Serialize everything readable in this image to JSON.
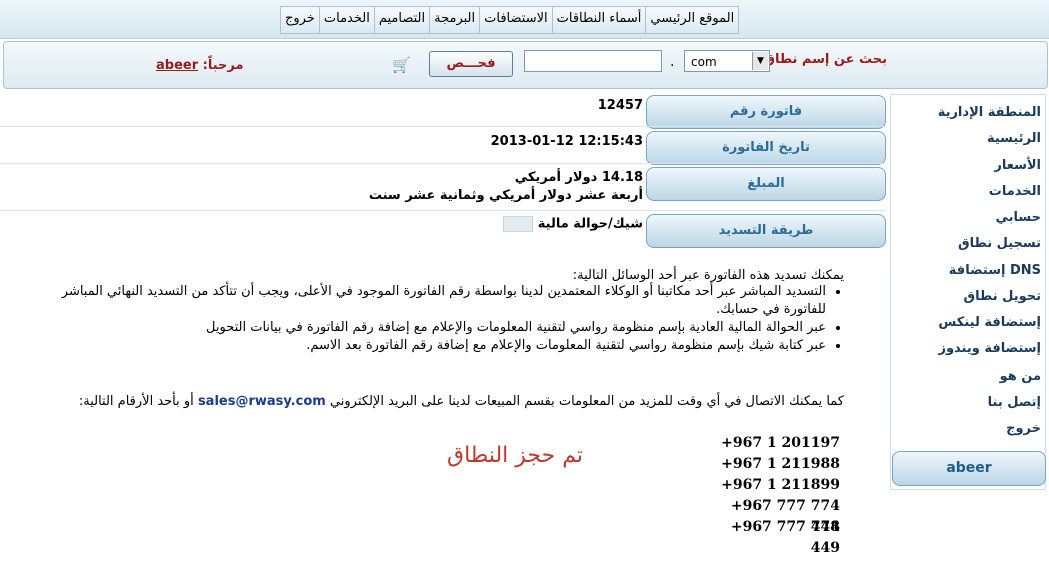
{
  "nav": {
    "items": [
      "الموقع الرئيسي",
      "أسماء النطاقات",
      "الاستضافات",
      "البرمجة",
      "التصاميم",
      "الخدمات",
      "خروج"
    ]
  },
  "search": {
    "label": "بحث عن إسم نطاق",
    "tld_selected": "com",
    "dot": ".",
    "name_value": "",
    "check_button": "فحـــص",
    "welcome_prefix": "مرحباً:",
    "username": "abeer"
  },
  "sidebar": {
    "items": [
      "المنطقة الإدارية",
      "الرئيسية",
      "الأسعار",
      "الخدمات",
      "حسابي",
      "تسجيل نطاق",
      "إستضافة DNS",
      "تحويل نطاق",
      "إستضافة لينكس",
      "إستضافة ويندوز",
      "من هو",
      "إتصل بنا",
      "خروج"
    ],
    "user_button": "abeer"
  },
  "invoice": {
    "number_label": "فاتورة رقم",
    "number_value": "12457",
    "date_label": "تاريخ الفاتورة",
    "date_value": "12:15:43 2013-01-12",
    "amount_label": "المبلغ",
    "amount_value": "14.18 دولار أمريكي",
    "amount_words": "أربعة عشر دولار أمريكي وثمانية عشر سنت",
    "method_label": "طريقة التسديد",
    "method_value": "شيك/حوالة مالية"
  },
  "payment_info": {
    "intro": "يمكنك تسديد هذه الفاتورة عبر أحد الوسائل التالية:",
    "bullets": [
      "التسديد المباشر عبر أحد مكاتبنا أو الوكلاء المعتمدين لدينا بواسطة رقم الفاتورة الموجود في الأعلى، ويجب أن تتأكد من التسديد النهائي المباشر للفاتورة في حسابك.",
      "عبر الحوالة المالية العادية بإسم منظومة رواسي لتقنية المعلومات والإعلام مع إضافة رقم الفاتورة في بيانات التحويل",
      "عبر كتابة شيك بإسم منظومة رواسي لتقنية المعلومات والإعلام مع إضافة رقم الفاتورة بعد الاسم."
    ],
    "contact_before": "كما يمكنك الاتصال في أي وقت للمزيد من المعلومات بقسم المبيعات لدينا على البريد الإلكتروني",
    "email": "sales@rwasy.com",
    "contact_after": "أو بأحد الأرقام التالية:",
    "phones": [
      "+967 1 201197",
      "+967 1 211988",
      "+967 1 211899",
      "+967 777 774 448",
      "+967 777 774 449"
    ],
    "reserved_message": "تم حجز النطاق"
  }
}
